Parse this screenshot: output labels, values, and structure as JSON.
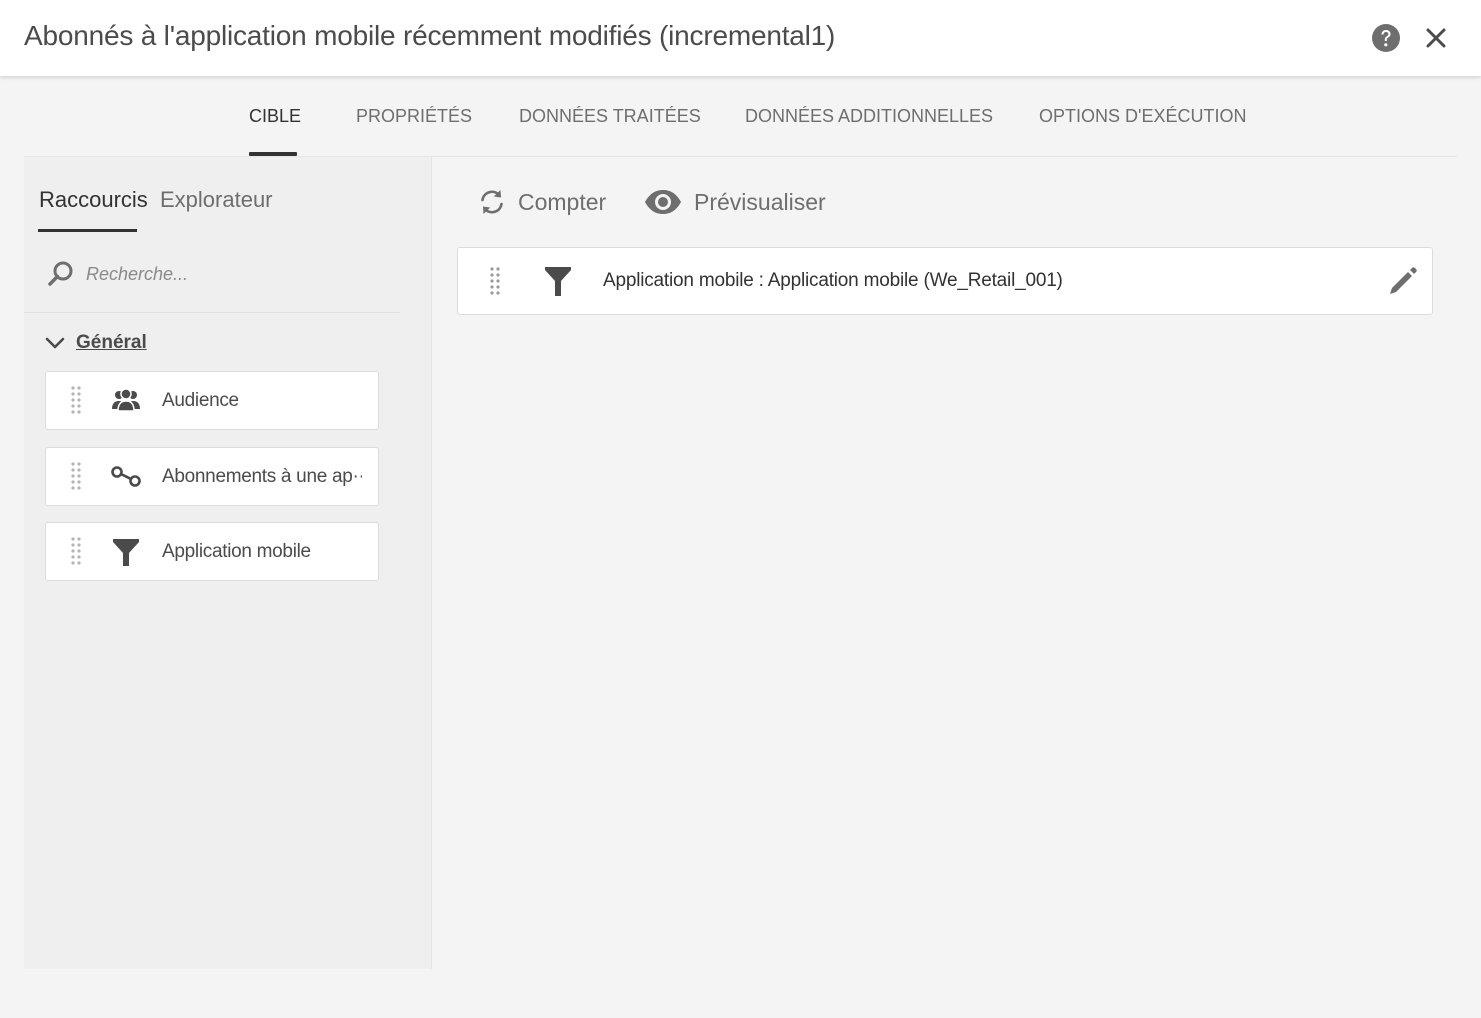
{
  "dialog": {
    "title": "Abonnés à l'application mobile récemment modifiés (incremental1)"
  },
  "tabs": [
    {
      "label": "CIBLE",
      "active": true
    },
    {
      "label": "PROPRIÉTÉS",
      "active": false
    },
    {
      "label": "DONNÉES TRAITÉES",
      "active": false
    },
    {
      "label": "DONNÉES ADDITIONNELLES",
      "active": false
    },
    {
      "label": "OPTIONS D'EXÉCUTION",
      "active": false
    }
  ],
  "left_panel": {
    "subtabs": [
      {
        "label": "Raccourcis",
        "active": true
      },
      {
        "label": "Explorateur",
        "active": false
      }
    ],
    "search": {
      "placeholder": "Recherche...",
      "value": ""
    },
    "section": {
      "label": "Général",
      "expanded": true
    },
    "shortcuts": [
      {
        "label": "Audience",
        "icon": "audience-icon"
      },
      {
        "label": "Abonnements à une ap···",
        "icon": "link-icon"
      },
      {
        "label": "Application mobile",
        "icon": "filter-icon"
      }
    ]
  },
  "main": {
    "toolbar": {
      "count_label": "Compter",
      "preview_label": "Prévisualiser"
    },
    "criteria": [
      {
        "label": "Application mobile : Application mobile (We_Retail_001)",
        "icon": "filter-icon"
      }
    ]
  },
  "colors": {
    "background": "#f4f4f4",
    "panel": "#efefef",
    "text": "#4b4b4b",
    "active_tab": "#323232",
    "icon": "#6e6e6e"
  }
}
